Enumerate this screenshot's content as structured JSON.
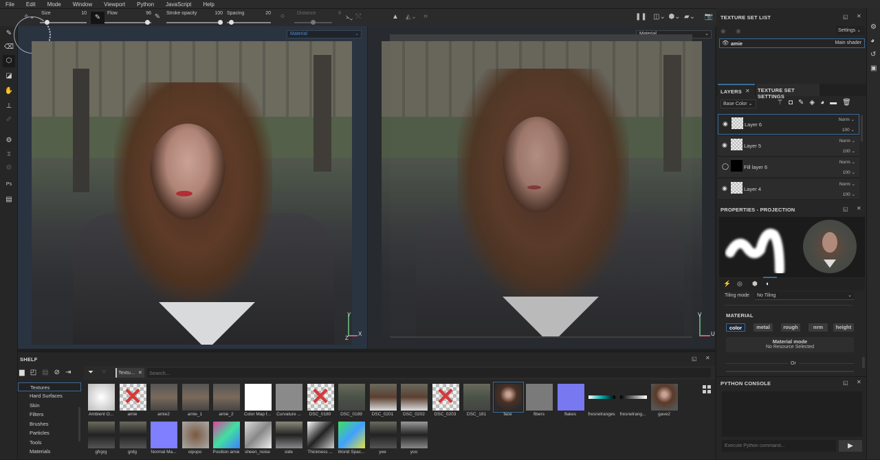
{
  "menu": [
    "File",
    "Edit",
    "Mode",
    "Window",
    "Viewport",
    "Python",
    "JavaScript",
    "Help"
  ],
  "toolbar": {
    "size": {
      "label": "Size",
      "value": "10",
      "fraction": 0.12
    },
    "flow": {
      "label": "Flow",
      "value": "96",
      "fraction": 0.96
    },
    "stroke_opacity": {
      "label": "Stroke opacity",
      "value": "100",
      "fraction": 1.0
    },
    "spacing": {
      "label": "Spacing",
      "value": "20",
      "fraction": 0.05
    },
    "distance": {
      "label": "Distance",
      "value": "8",
      "fraction": 0.5
    }
  },
  "viewports": {
    "left": {
      "channel": "Material",
      "gizmo": {
        "y": "Y",
        "x": "X",
        "z": "Z"
      }
    },
    "right": {
      "channel": "Material",
      "gizmo": {
        "y": "V",
        "x": "U"
      }
    }
  },
  "shelf": {
    "title": "SHELF",
    "filter_tag": "Textu...",
    "search_placeholder": "Search...",
    "categories": [
      "Textures",
      "Hard Surfaces",
      "Skin",
      "Filters",
      "Brushes",
      "Particles",
      "Tools",
      "Materials"
    ],
    "selected_category": "Textures",
    "row1": [
      "Ambient O...",
      "amie",
      "amie2",
      "amie_1",
      "amie_2",
      "Color Map f...",
      "Curvature ...",
      "DSC_0180",
      "DSC_0189",
      "DSC_0201",
      "DSC_0202",
      "DSC_0203",
      "DSC_181",
      "face",
      "fibers",
      "flakes",
      "fresnelranges",
      "fresnelrang...",
      "gave2"
    ],
    "row2": [
      "gfrgrg",
      "grdg",
      "Normal Ma...",
      "oipopo",
      "Position amie",
      "sheen_noise",
      "side",
      "Thickness ...",
      "World Spac...",
      "yee",
      "yoo"
    ],
    "selected_item": "face"
  },
  "texture_set_list": {
    "title": "TEXTURE SET LIST",
    "settings_label": "Settings",
    "item": {
      "name": "amie",
      "shader": "Main shader"
    }
  },
  "layers": {
    "tab_layers": "LAYERS",
    "tab_tss": "TEXTURE SET SETTINGS",
    "channel": "Base Color",
    "rows": [
      {
        "name": "Layer 6",
        "blend": "Norm",
        "opacity": "100",
        "selected": true
      },
      {
        "name": "Layer 5",
        "blend": "Norm",
        "opacity": "100"
      },
      {
        "name": "Fill layer 6",
        "blend": "Norm",
        "opacity": "100"
      },
      {
        "name": "Layer 4",
        "blend": "Norm",
        "opacity": "100"
      }
    ]
  },
  "properties": {
    "title": "PROPERTIES - PROJECTION",
    "tiling_label": "Tiling mode",
    "tiling_value": "No Tiling",
    "material_heading": "MATERIAL",
    "channels": [
      "color",
      "metal",
      "rough",
      "nrm",
      "height"
    ],
    "material_mode_title": "Material mode",
    "material_mode_value": "No Resource Selected",
    "or_label": "Or"
  },
  "python_console": {
    "title": "PYTHON CONSOLE",
    "placeholder": "Execute Python command..."
  },
  "colors": {
    "accent": "#3b6a96",
    "channel_selected": "#4a8ad0",
    "gizmo_x": "#d06070",
    "gizmo_y": "#60a070"
  }
}
